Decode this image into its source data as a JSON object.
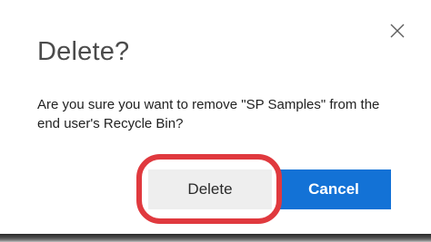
{
  "dialog": {
    "title": "Delete?",
    "message": "Are you sure you want to remove \"SP Samples\" from the end user's Recycle Bin?",
    "buttons": {
      "delete_label": "Delete",
      "cancel_label": "Cancel"
    }
  },
  "icons": {
    "close": "close-icon"
  },
  "colors": {
    "primary_button": "#1372d6",
    "secondary_button": "#eeeeee",
    "highlight": "#e0393e"
  }
}
